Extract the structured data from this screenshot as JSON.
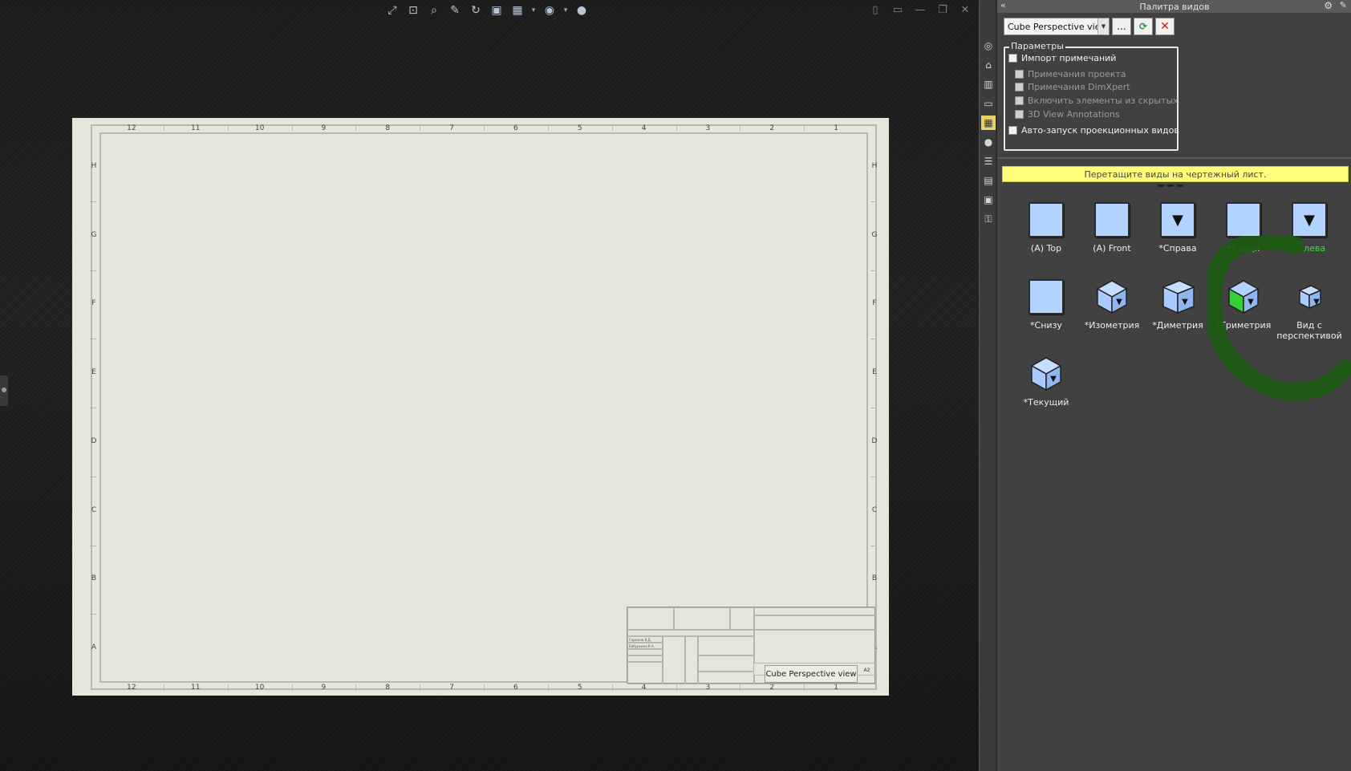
{
  "heads_up_toolbar": {
    "icons": [
      "zoom-to-fit-icon",
      "zoom-area-icon",
      "zoom-previous-icon",
      "pan-icon",
      "rotate-icon",
      "view-orientation-icon",
      "display-style-icon",
      "hide-show-icon",
      "appearance-icon"
    ]
  },
  "window_controls": [
    "tile-horizontal-icon",
    "tile-vertical-icon",
    "minimize-icon",
    "restore-icon",
    "close-icon"
  ],
  "sheet": {
    "top_zone_numbers": [
      "12",
      "11",
      "10",
      "9",
      "8",
      "7",
      "6",
      "5",
      "4",
      "3",
      "2",
      "1"
    ],
    "bottom_zone_numbers": [
      "12",
      "11",
      "10",
      "9",
      "8",
      "7",
      "6",
      "5",
      "4",
      "3",
      "2",
      "1"
    ],
    "left_zone_letters": [
      "H",
      "G",
      "F",
      "E",
      "D",
      "C",
      "B",
      "A"
    ],
    "right_zone_letters": [
      "H",
      "G",
      "F",
      "E",
      "D",
      "C",
      "B",
      "A"
    ],
    "title_block": {
      "drawing_title": "Cube Perspective view",
      "sheet_size": "A2",
      "name_drawn": "Горюнов В.Д.",
      "name_checked": "Бабуркина В.А."
    }
  },
  "side_toolbar": {
    "icons": [
      "solidworks-resources-icon",
      "home-icon",
      "design-library-icon",
      "file-explorer-icon",
      "view-palette-icon",
      "appearances-icon",
      "custom-properties-icon",
      "forum-icon",
      "document-icon",
      "key-icon"
    ]
  },
  "panel": {
    "title": "Палитра видов",
    "model_select": "Cube Perspective view",
    "browse_label": "...",
    "params": {
      "legend": "Параметры",
      "import_annotations": "Импорт примечаний",
      "project_annotations": "Примечания проекта",
      "dimxpert_annotations": "Примечания DimXpert",
      "include_hidden": "Включить элементы из скрытых",
      "view_3d_annotations": "3D View Annotations",
      "auto_start": "Авто-запуск проекционных видов"
    },
    "hint": "Перетащите виды на чертежный лист.",
    "views": [
      {
        "label": "(A) Top",
        "kind": "flat",
        "green": false
      },
      {
        "label": "(A) Front",
        "kind": "flat",
        "green": false
      },
      {
        "label": "*Справа",
        "kind": "flat-logo",
        "green": false
      },
      {
        "label": "*Сзади",
        "kind": "flat",
        "green": false
      },
      {
        "label": "*Слева",
        "kind": "flat-logo",
        "green": true
      },
      {
        "label": "*Снизу",
        "kind": "flat",
        "green": false
      },
      {
        "label": "*Изометрия",
        "kind": "iso",
        "green": false
      },
      {
        "label": "*Диметрия",
        "kind": "dim",
        "green": false
      },
      {
        "label": "*Триметрия",
        "kind": "tri",
        "green": false
      },
      {
        "label": "Вид с перспективой",
        "kind": "persp",
        "green": false
      },
      {
        "label": "*Текущий",
        "kind": "iso",
        "green": false
      }
    ]
  }
}
